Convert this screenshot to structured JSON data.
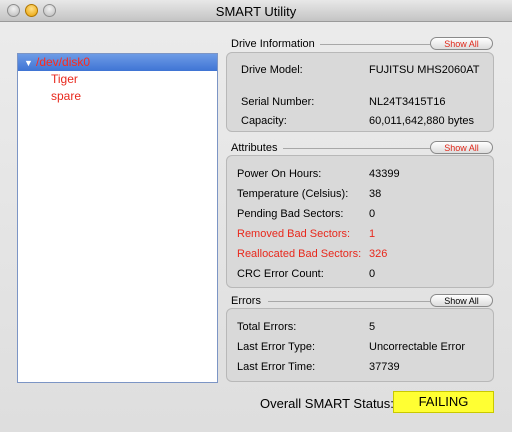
{
  "window": {
    "title": "SMART Utility"
  },
  "sidebar": {
    "disk": "/dev/disk0",
    "volumes": [
      "Tiger",
      "spare"
    ]
  },
  "drive_info": {
    "title": "Drive Information",
    "show_all": "Show All",
    "model_label": "Drive Model:",
    "model_value": "FUJITSU MHS2060AT",
    "serial_label": "Serial Number:",
    "serial_value": "NL24T3415T16",
    "capacity_label": "Capacity:",
    "capacity_value": "60,011,642,880 bytes"
  },
  "attributes": {
    "title": "Attributes",
    "show_all": "Show All",
    "rows": [
      {
        "label": "Power On Hours:",
        "value": "43399",
        "alert": false
      },
      {
        "label": "Temperature (Celsius):",
        "value": "38",
        "alert": false
      },
      {
        "label": "Pending Bad Sectors:",
        "value": "0",
        "alert": false
      },
      {
        "label": "Removed Bad Sectors:",
        "value": "1",
        "alert": true
      },
      {
        "label": "Reallocated Bad Sectors:",
        "value": "326",
        "alert": true
      },
      {
        "label": "CRC Error Count:",
        "value": "0",
        "alert": false
      }
    ]
  },
  "errors": {
    "title": "Errors",
    "show_all": "Show All",
    "rows": [
      {
        "label": "Total Errors:",
        "value": "5"
      },
      {
        "label": "Last Error Type:",
        "value": "Uncorrectable Error"
      },
      {
        "label": "Last Error Time:",
        "value": "37739"
      }
    ]
  },
  "overall": {
    "label": "Overall SMART Status:",
    "status": "FAILING",
    "status_color": "#ffff33"
  },
  "colors": {
    "alert": "#e8281c",
    "selection": "#3f74d4"
  }
}
